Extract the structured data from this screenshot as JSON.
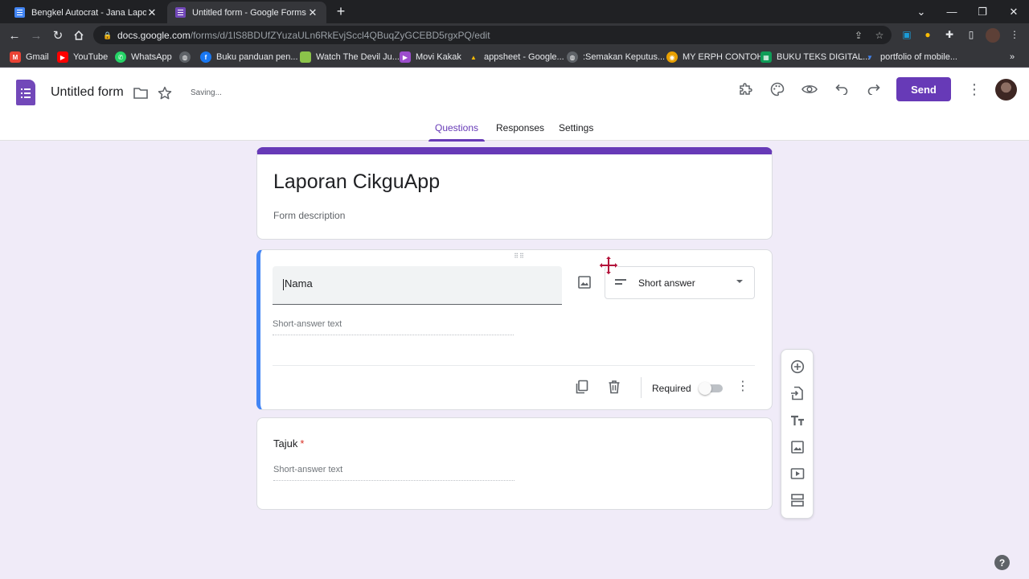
{
  "browser": {
    "tabs": [
      {
        "title": "Bengkel Autocrat - Jana Laporan",
        "active": false,
        "favicon_color": "#4285f4"
      },
      {
        "title": "Untitled form - Google Forms",
        "active": true,
        "favicon_color": "#7248b9"
      }
    ],
    "url": {
      "host": "docs.google.com",
      "path": "/forms/d/1lS8BDUfZYuzaULn6RkEvjSccl4QBuqZyGCEBD5rgxPQ/edit"
    },
    "bookmarks": [
      {
        "label": "Gmail",
        "icon": "gmail-icon",
        "color": "#ea4335"
      },
      {
        "label": "YouTube",
        "icon": "youtube-icon",
        "color": "#ff0000"
      },
      {
        "label": "WhatsApp",
        "icon": "whatsapp-icon",
        "color": "#25d366"
      },
      {
        "label": "",
        "icon": "globe-icon",
        "color": "#9aa0a6"
      },
      {
        "label": "Buku panduan pen...",
        "icon": "facebook-icon",
        "color": "#1877f2"
      },
      {
        "label": "Watch The Devil Ju...",
        "icon": "movie-icon",
        "color": "#8bc34a"
      },
      {
        "label": "Movi Kakak",
        "icon": "video-icon",
        "color": "#9c4dcc"
      },
      {
        "label": "appsheet - Google...",
        "icon": "drive-icon",
        "color": "#fbbc04"
      },
      {
        "label": ":Semakan Keputus...",
        "icon": "globe-icon",
        "color": "#9aa0a6"
      },
      {
        "label": "MY ERPH CONTOH",
        "icon": "chrome-icon",
        "color": "#e8a000"
      },
      {
        "label": "BUKU TEKS DIGITAL...",
        "icon": "sheets-icon",
        "color": "#0f9d58"
      },
      {
        "label": "portfolio of mobile...",
        "icon": "bookmark-icon",
        "color": "#4285f4"
      }
    ]
  },
  "header": {
    "doc_title": "Untitled form",
    "status": "Saving...",
    "send_label": "Send",
    "tabs": [
      {
        "label": "Questions",
        "active": true
      },
      {
        "label": "Responses",
        "active": false
      },
      {
        "label": "Settings",
        "active": false
      }
    ]
  },
  "form": {
    "title": "Laporan CikguApp",
    "description_placeholder": "Form description",
    "questions": [
      {
        "title": "Nama",
        "type": "Short answer",
        "answer_placeholder": "Short-answer text",
        "required_label": "Required",
        "required": false
      },
      {
        "title": "Tajuk",
        "required_mark": "*",
        "answer_placeholder": "Short-answer text"
      }
    ]
  },
  "side_toolbar": [
    "add-question-icon",
    "import-questions-icon",
    "add-title-icon",
    "add-image-icon",
    "add-video-icon",
    "add-section-icon"
  ],
  "help_label": "?",
  "colors": {
    "accent": "#673ab7",
    "focus": "#4285f4",
    "background": "#f0ebf8"
  }
}
